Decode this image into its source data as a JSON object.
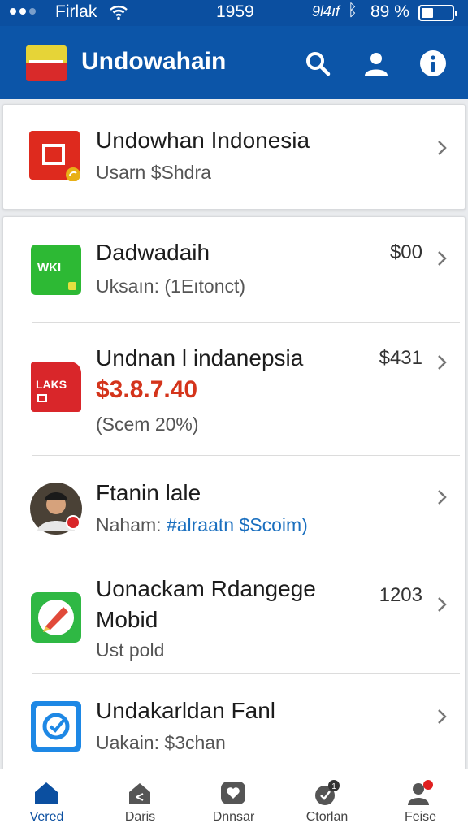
{
  "status_bar": {
    "carrier": "Firlak",
    "time": "1959",
    "network": "9l4ıf",
    "battery": "89 %"
  },
  "app_bar": {
    "title": "Undowahain"
  },
  "top_card": {
    "title": "Undowhan Indonesia",
    "subtitle": "Usarn $Shdra"
  },
  "items": [
    {
      "title": "Dadwadaih",
      "subtitle": "Uksaın: (1Eıtonct)",
      "price": "$00",
      "icon_label": "WKI"
    },
    {
      "title": "Undnan l indanepsia",
      "price_highlight": "$3.8.7.40",
      "subtitle": "(Scem 20%)",
      "price": "$431",
      "icon_label": "LAKS"
    },
    {
      "title": "Ftanin lale",
      "subtitle_prefix": "Naham:",
      "subtitle_link": "#alraatn $Scoim)",
      "price": ""
    },
    {
      "title": "Uonackam Rdangege",
      "title_line2": "Mobid",
      "subtitle": "Ust pold",
      "price": "1203"
    },
    {
      "title": "Undakarldan Fanl",
      "subtitle": "Uakain: $3chan",
      "price": ""
    }
  ],
  "bottom_nav": [
    {
      "label": "Vered",
      "icon": "home-icon",
      "active": true
    },
    {
      "label": "Daris",
      "icon": "house-share-icon",
      "active": false
    },
    {
      "label": "Dnnsar",
      "icon": "heart-chat-icon",
      "active": false
    },
    {
      "label": "Ctorlan",
      "icon": "notification-badge-icon",
      "badge": "1",
      "active": false
    },
    {
      "label": "Feise",
      "icon": "profile-icon",
      "active": false
    }
  ],
  "colors": {
    "header_blue": "#0c55a8",
    "accent_yellow": "#e8b017",
    "price_red": "#d4341b",
    "link_blue": "#1a6fbf"
  }
}
